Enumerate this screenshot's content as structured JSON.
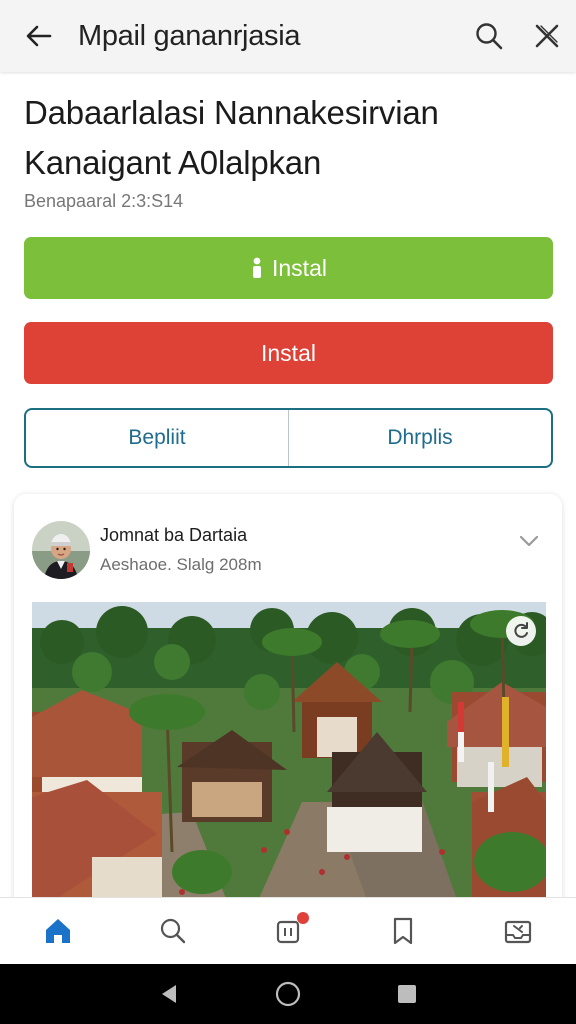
{
  "appbar": {
    "title": "Mpail gananrjasia",
    "back_icon": "arrow-left-icon",
    "search_icon": "search-icon",
    "close_icon": "close-icon"
  },
  "article": {
    "headline_line1": "Dabaarlalasi Nannakesirvian",
    "headline_line2": "Kanaigant A0lalpkan",
    "meta": "Benapaaral 2:3:S14"
  },
  "buttons": {
    "primary_label": "Instal",
    "primary_icon": "person-icon",
    "secondary_label": "Instal",
    "split_left": "Bepliit",
    "split_right": "Dhrplis"
  },
  "post": {
    "author": "Jomnat ba Dartaia",
    "subtitle": "Aeshaoe. Slalg 208m",
    "menu_icon": "chevron-down-icon",
    "photo_badge_icon": "refresh-icon"
  },
  "bottom_nav": [
    {
      "icon": "home-icon",
      "active": true
    },
    {
      "icon": "search-icon",
      "active": false
    },
    {
      "icon": "notifications-icon",
      "active": false,
      "has_badge": true
    },
    {
      "icon": "bookmark-icon",
      "active": false
    },
    {
      "icon": "inbox-icon",
      "active": false
    }
  ],
  "colors": {
    "green": "#7cbf3a",
    "red": "#de4136",
    "teal": "#1b6f80",
    "nav_active": "#1a73c8"
  }
}
